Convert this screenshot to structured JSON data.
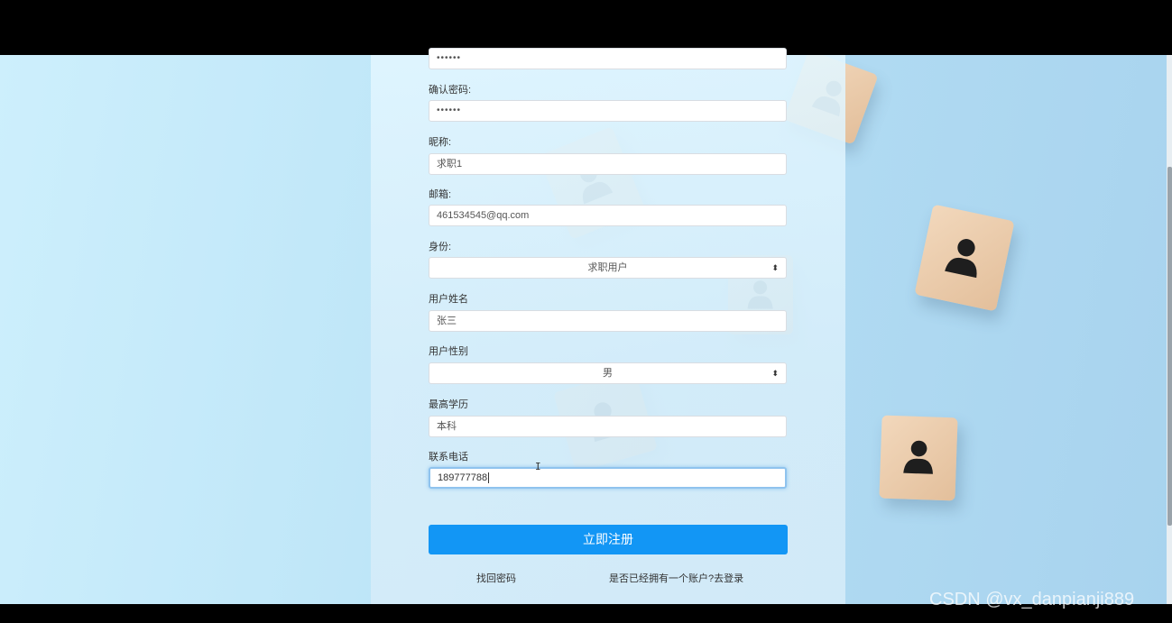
{
  "form": {
    "password_value": "••••••",
    "confirm_password": {
      "label": "确认密码:",
      "value": "••••••"
    },
    "nickname": {
      "label": "昵称:",
      "value": "求职1"
    },
    "email": {
      "label": "邮箱:",
      "value": "461534545@qq.com"
    },
    "role": {
      "label": "身份:",
      "value": "求职用户"
    },
    "real_name": {
      "label": "用户姓名",
      "value": "张三"
    },
    "gender": {
      "label": "用户性别",
      "value": "男"
    },
    "education": {
      "label": "最高学历",
      "value": "本科"
    },
    "phone": {
      "label": "联系电话",
      "value": "189777788"
    },
    "submit_label": "立即注册",
    "forgot_password": "找回密码",
    "login_link": "是否已经拥有一个账户?去登录"
  },
  "watermark": "CSDN @vx_danpianji889",
  "colors": {
    "accent": "#1296f5",
    "background": "#b2dcf3"
  }
}
